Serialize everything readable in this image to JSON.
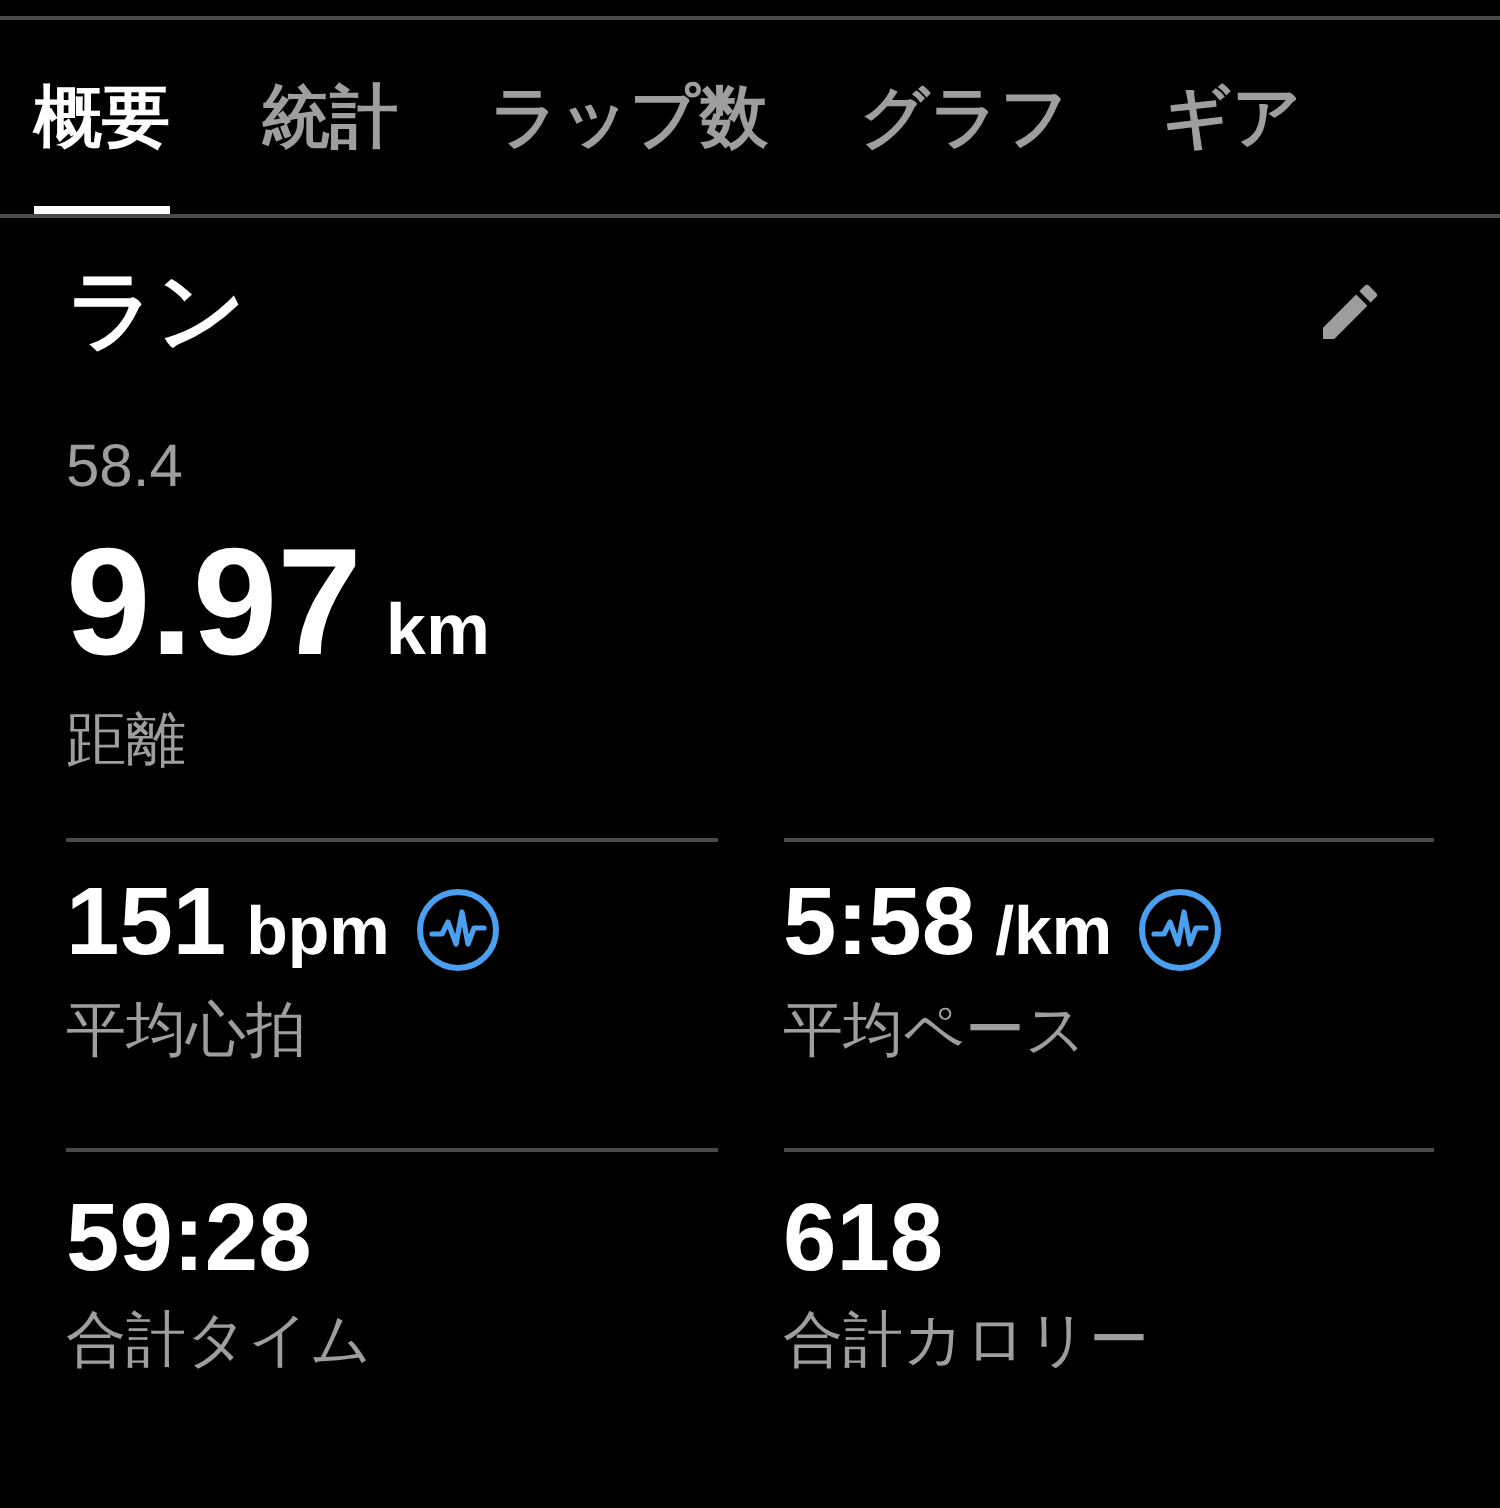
{
  "tabs": [
    {
      "label": "概要",
      "selected": true
    },
    {
      "label": "統計",
      "selected": false
    },
    {
      "label": "ラップ数",
      "selected": false
    },
    {
      "label": "グラフ",
      "selected": false
    },
    {
      "label": "ギア",
      "selected": false
    }
  ],
  "activity": {
    "title": "ラン",
    "subtitle": "58.4"
  },
  "headline": {
    "value": "9.97",
    "unit": "km",
    "label": "距離"
  },
  "stats": [
    {
      "value": "151",
      "unit": "bpm",
      "label": "平均心拍",
      "graph_icon": true
    },
    {
      "value": "5:58",
      "unit": "/km",
      "label": "平均ペース",
      "graph_icon": true
    },
    {
      "value": "59:28",
      "label": "合計タイム",
      "graph_icon": false
    },
    {
      "value": "618",
      "label": "合計カロリー",
      "graph_icon": false
    }
  ]
}
